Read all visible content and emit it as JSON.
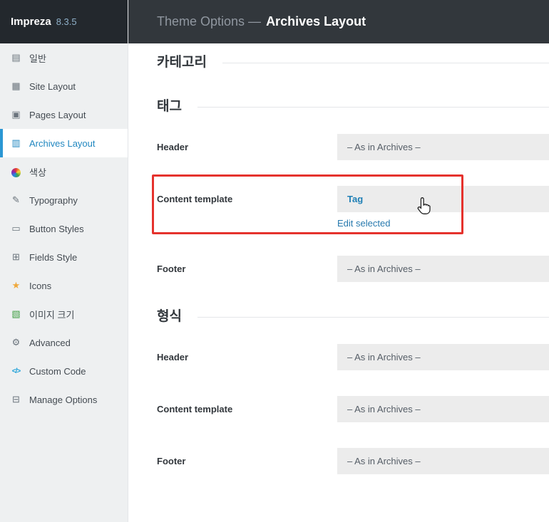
{
  "colors": {
    "topbar_bg": "#32373c",
    "sidebar_header_bg": "#23282d",
    "sidebar_bg": "#eef0f1",
    "active_item_blue": "#2187c0",
    "link_blue": "#2779ae",
    "highlight_red": "#e5322d",
    "select_bg": "#ececec",
    "star_yellow": "#efa83b",
    "image_green": "#43a047",
    "code_blue": "#1da0d8"
  },
  "sidebar": {
    "brand": {
      "name": "Impreza",
      "version": "8.3.5"
    },
    "items": [
      {
        "label": "일반",
        "glyph": "▤"
      },
      {
        "label": "Site Layout",
        "glyph": "▦"
      },
      {
        "label": "Pages Layout",
        "glyph": "▣"
      },
      {
        "label": "Archives Layout",
        "glyph": "▥",
        "active": true
      },
      {
        "label": "색상",
        "glyph": ""
      },
      {
        "label": "Typography",
        "glyph": "✎"
      },
      {
        "label": "Button Styles",
        "glyph": "▭"
      },
      {
        "label": "Fields Style",
        "glyph": "⊞"
      },
      {
        "label": "Icons",
        "glyph": "★"
      },
      {
        "label": "이미지 크기",
        "glyph": "▧"
      },
      {
        "label": "Advanced",
        "glyph": "⚙"
      },
      {
        "label": "Custom Code",
        "glyph": "</>"
      },
      {
        "label": "Manage Options",
        "glyph": "⊟"
      }
    ]
  },
  "topbar": {
    "prefix": "Theme Options —",
    "title": "Archives Layout"
  },
  "main": {
    "sections": [
      {
        "title": "카테고리"
      },
      {
        "title": "태그",
        "rows": [
          {
            "label": "Header",
            "value": "– As in Archives –"
          },
          {
            "label": "Content template",
            "value": "Tag",
            "link": "Edit selected"
          },
          {
            "label": "Footer",
            "value": "– As in Archives –"
          }
        ]
      },
      {
        "title": "형식",
        "rows": [
          {
            "label": "Header",
            "value": "– As in Archives –"
          },
          {
            "label": "Content template",
            "value": "– As in Archives –"
          },
          {
            "label": "Footer",
            "value": "– As in Archives –"
          }
        ]
      }
    ]
  },
  "annotation": {
    "kind": "highlight-box"
  },
  "cursor": {
    "kind": "hand-pointer"
  }
}
